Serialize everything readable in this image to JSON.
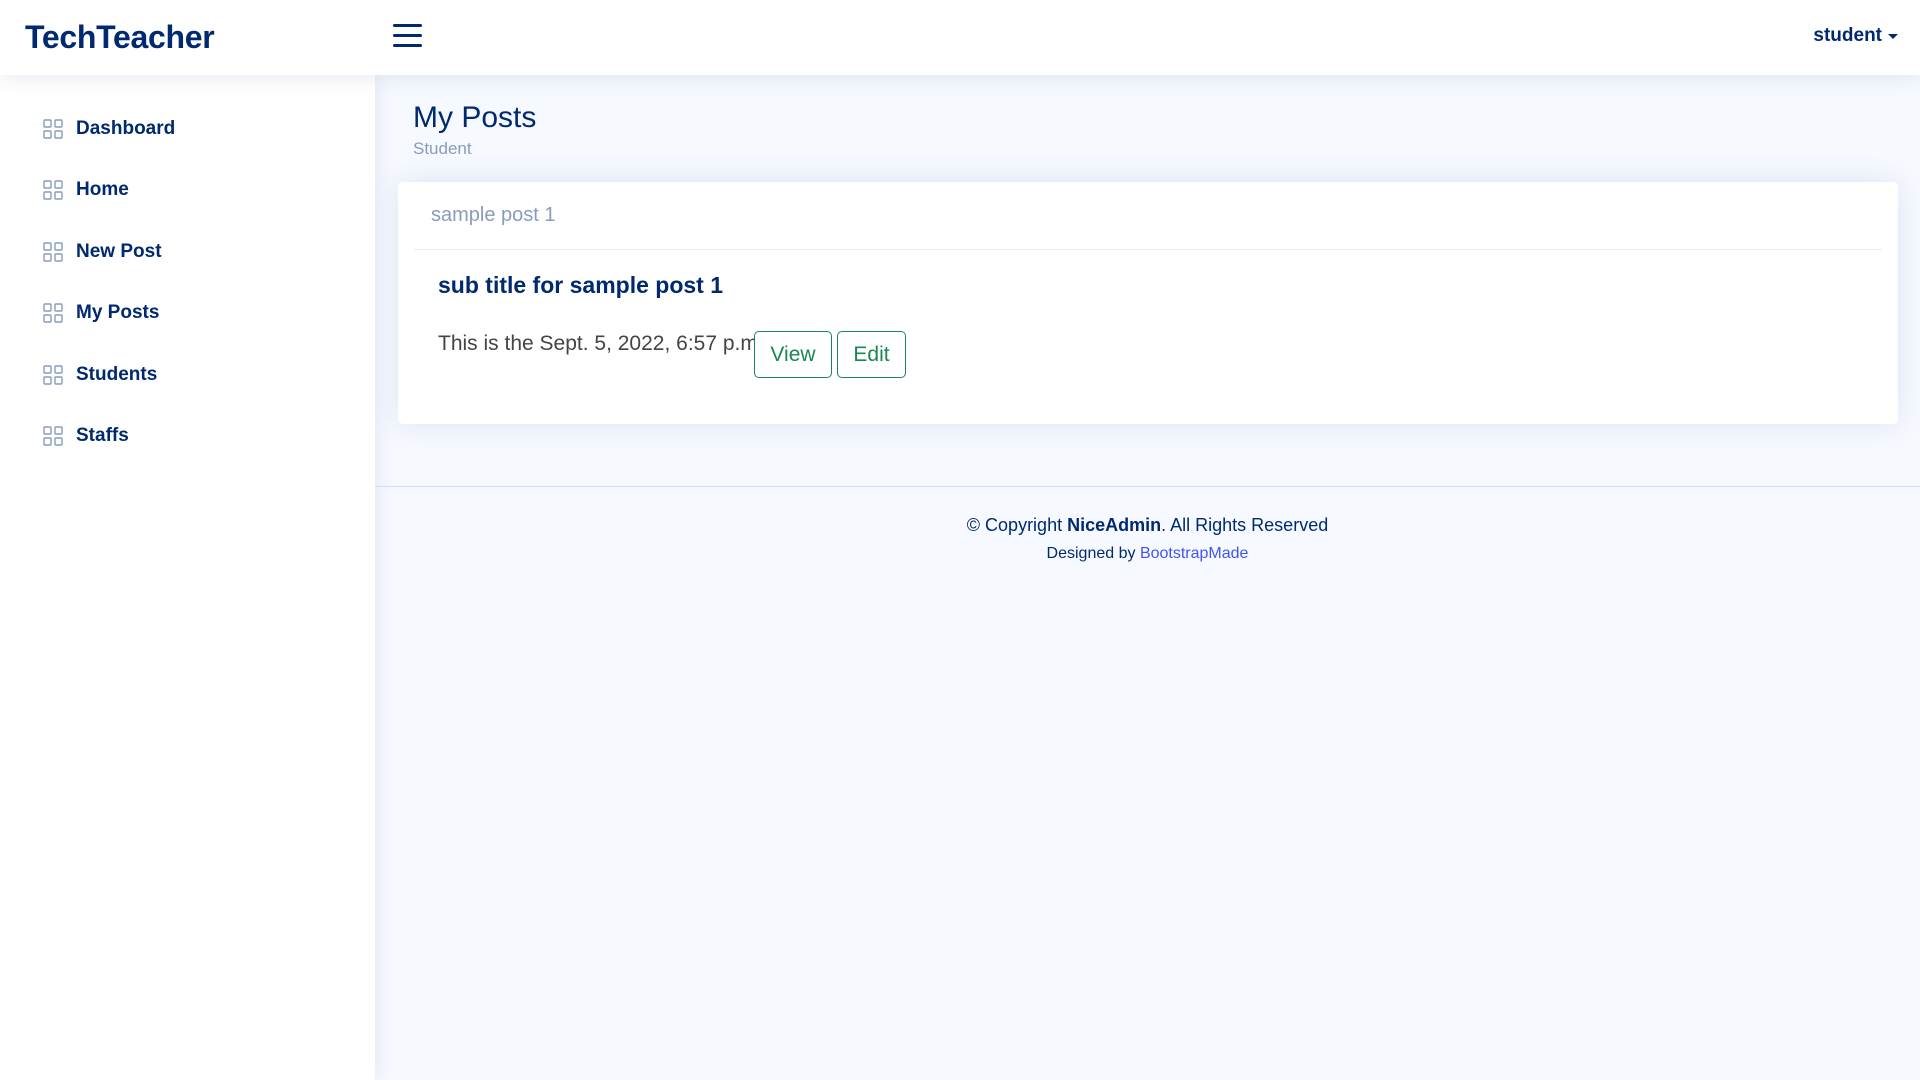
{
  "header": {
    "logo": "TechTeacher",
    "user_label": "student"
  },
  "sidebar": {
    "items": [
      {
        "label": "Dashboard",
        "icon": "grid-icon"
      },
      {
        "label": "Home",
        "icon": "grid-icon"
      },
      {
        "label": "New Post",
        "icon": "grid-icon"
      },
      {
        "label": "My Posts",
        "icon": "grid-icon"
      },
      {
        "label": "Students",
        "icon": "grid-icon"
      },
      {
        "label": "Staffs",
        "icon": "grid-icon"
      }
    ]
  },
  "page": {
    "title": "My Posts",
    "breadcrumb": "Student"
  },
  "posts": [
    {
      "header": "sample post 1",
      "title": "sub title for sample post 1",
      "text": "This is the Sept. 5, 2022, 6:57 p.m.",
      "view_label": "View",
      "edit_label": "Edit"
    }
  ],
  "footer": {
    "copyright_prefix": "© Copyright",
    "brand": "NiceAdmin",
    "copyright_suffix": ". All Rights Reserved",
    "designed_by": "Designed by",
    "designer_link": "BootstrapMade"
  },
  "colors": {
    "primary": "#012970",
    "accent_link": "#4154f1",
    "button_outline": "#198754",
    "muted": "#899bbd",
    "background": "#f6f9ff"
  }
}
